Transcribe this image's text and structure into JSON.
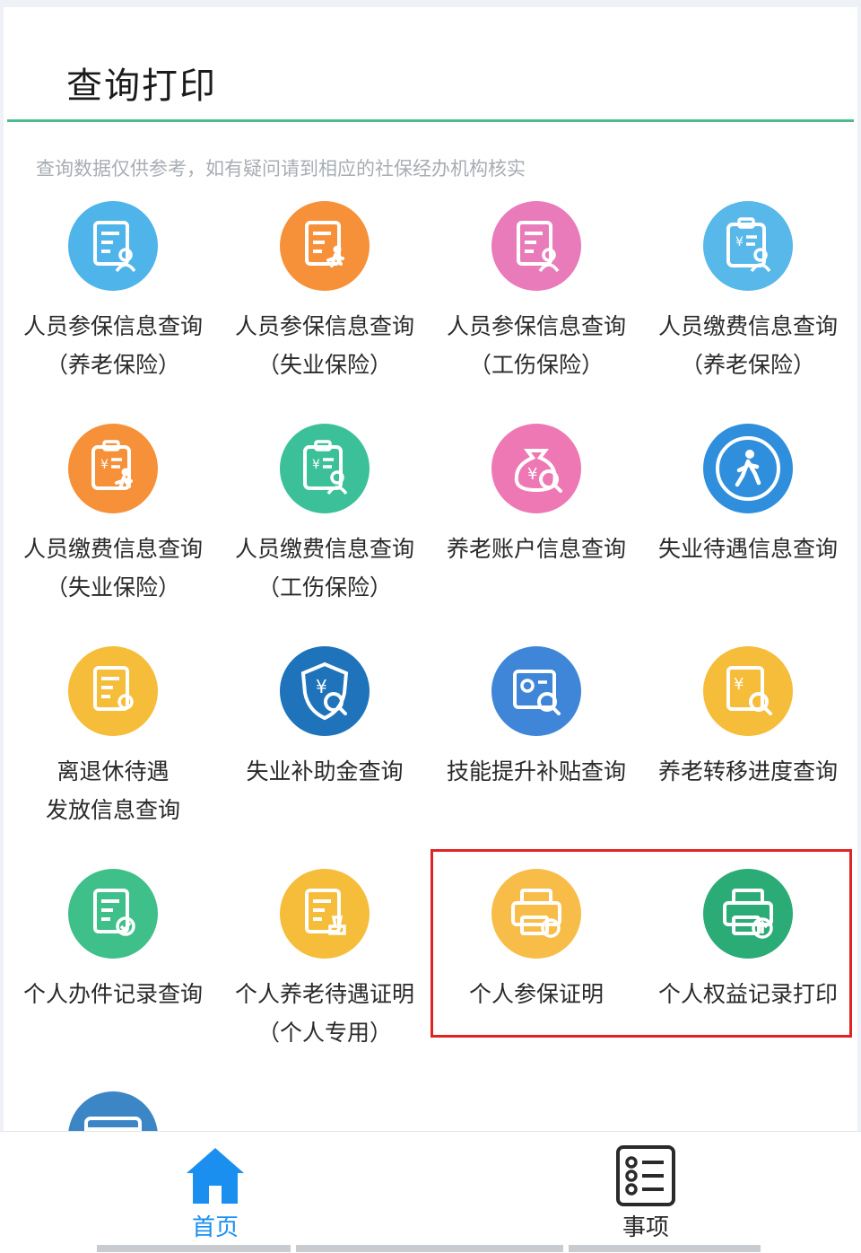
{
  "page": {
    "title": "查询打印"
  },
  "notice": "查询数据仅供参考，如有疑问请到相应的社保经办机构核实",
  "tiles": [
    {
      "line1": "人员参保信息查询",
      "line2": "（养老保险）",
      "icon": "doc-person-icon",
      "color": "#4fb4ea"
    },
    {
      "line1": "人员参保信息查询",
      "line2": "（失业保险）",
      "icon": "doc-walker-icon",
      "color": "#f6913a"
    },
    {
      "line1": "人员参保信息查询",
      "line2": "（工伤保险）",
      "icon": "doc-injury-icon",
      "color": "#ea7bbb"
    },
    {
      "line1": "人员缴费信息查询",
      "line2": "（养老保险）",
      "icon": "clipboard-yuan-person-icon",
      "color": "#58b8ea"
    },
    {
      "line1": "人员缴费信息查询",
      "line2": "（失业保险）",
      "icon": "clipboard-yuan-walker-icon",
      "color": "#f6913a"
    },
    {
      "line1": "人员缴费信息查询",
      "line2": "（工伤保险）",
      "icon": "clipboard-yuan-injury-icon",
      "color": "#3cc09a"
    },
    {
      "line1": "养老账户信息查询",
      "line2": "",
      "icon": "money-bag-search-icon",
      "color": "#ee78b4"
    },
    {
      "line1": "失业待遇信息查询",
      "line2": "",
      "icon": "walking-person-icon",
      "color": "#2f8fdc"
    },
    {
      "line1": "离退休待遇",
      "line2": "发放信息查询",
      "icon": "retire-doc-icon",
      "color": "#f5bd3a"
    },
    {
      "line1": "失业补助金查询",
      "line2": "",
      "icon": "shield-yuan-search-icon",
      "color": "#1e73bb"
    },
    {
      "line1": "技能提升补贴查询",
      "line2": "",
      "icon": "certificate-search-icon",
      "color": "#3f86d8"
    },
    {
      "line1": "养老转移进度查询",
      "line2": "",
      "icon": "yuan-doc-search-icon",
      "color": "#f5bd3a"
    },
    {
      "line1": "个人办件记录查询",
      "line2": "",
      "icon": "doc-check-icon",
      "color": "#3fbf8a"
    },
    {
      "line1": "个人养老待遇证明",
      "line2": "（个人专用）",
      "icon": "doc-stamp-icon",
      "color": "#f5bd3a"
    },
    {
      "line1": "个人参保证明",
      "line2": "",
      "icon": "printer-bao-icon",
      "color": "#f7bd48"
    },
    {
      "line1": "个人权益记录打印",
      "line2": "",
      "icon": "printer-upload-icon",
      "color": "#2bab76"
    }
  ],
  "tabs": [
    {
      "label": "首页",
      "icon": "home-icon",
      "active": true,
      "color": "#1b8ff0"
    },
    {
      "label": "事项",
      "icon": "list-icon",
      "active": false,
      "color": "#2a2a2a"
    }
  ],
  "colors": {
    "accent_rule": "#4dbb8c",
    "highlight_border": "#e02424"
  }
}
